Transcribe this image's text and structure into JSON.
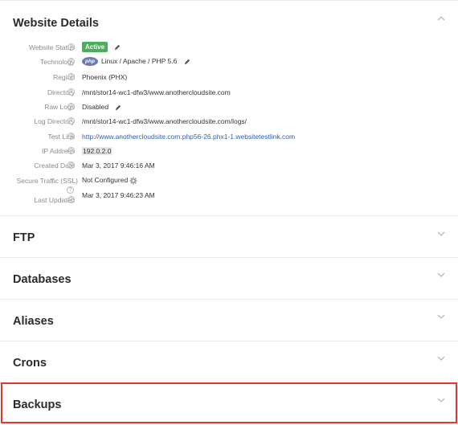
{
  "website_details": {
    "title": "Website Details",
    "rows": [
      {
        "label": "Website Status",
        "value": "Active"
      },
      {
        "label": "Technology",
        "value": "Linux / Apache / PHP 5.6",
        "logo_text": "php"
      },
      {
        "label": "Region",
        "value": "Phoenix (PHX)"
      },
      {
        "label": "Directory",
        "value": "/mnt/stor14-wc1-dfw3/www.anothercloudsite.com"
      },
      {
        "label": "Raw Logs",
        "value": "Disabled"
      },
      {
        "label": "Log Directory",
        "value": "/mnt/stor14-wc1-dfw3/www.anothercloudsite.com/logs/"
      },
      {
        "label": "Test Link",
        "value": "http://www.anothercloudsite.com.php56-26.phx1-1.websitetestlink.com"
      },
      {
        "label": "IP Address",
        "value": "192.0.2.0"
      },
      {
        "label": "Created Date",
        "value": "Mar 3, 2017 9:46:16 AM"
      },
      {
        "label": "Secure Traffic (SSL)",
        "value": "Not Configured"
      },
      {
        "label": "Last Updated",
        "value": "Mar 3, 2017 9:46:23 AM"
      }
    ],
    "help_glyph": "?"
  },
  "sections": {
    "ftp": "FTP",
    "databases": "Databases",
    "aliases": "Aliases",
    "crons": "Crons",
    "backups": "Backups"
  },
  "colors": {
    "active_badge": "#4bae5a",
    "link": "#2f5fa8",
    "highlight_border": "#e8362a"
  },
  "icons": [
    "chevron-up-icon",
    "chevron-down-icon",
    "pencil-icon",
    "gear-icon",
    "help-icon",
    "php-logo"
  ]
}
